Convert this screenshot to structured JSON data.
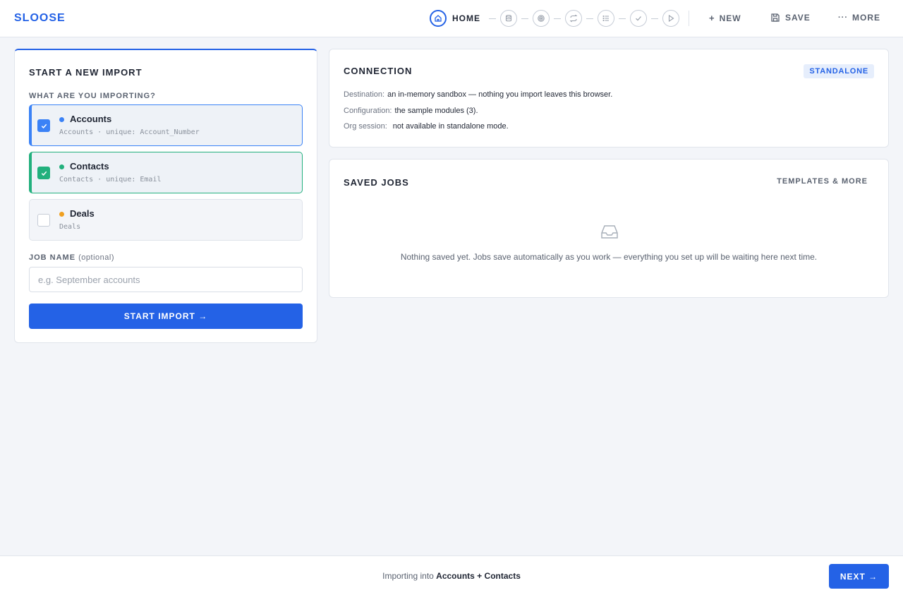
{
  "app": {
    "brand": "SLOOSE"
  },
  "stepper": {
    "active_label": "HOME",
    "steps": [
      {
        "icon": "home-icon",
        "active": true
      },
      {
        "icon": "database-icon"
      },
      {
        "icon": "target-icon"
      },
      {
        "icon": "sync-icon"
      },
      {
        "icon": "list-icon"
      },
      {
        "icon": "check-icon"
      },
      {
        "icon": "play-icon"
      }
    ]
  },
  "toolbar": {
    "new_label": "NEW",
    "save_label": "SAVE",
    "more_label": "MORE"
  },
  "import_card": {
    "title": "START A NEW IMPORT",
    "question": "WHAT ARE YOU IMPORTING?",
    "options": [
      {
        "name": "Accounts",
        "sub": "Accounts · unique: Account_Number",
        "checked": true,
        "color": "#3b82f6"
      },
      {
        "name": "Contacts",
        "sub": "Contacts · unique: Email",
        "checked": true,
        "color": "#22b07d"
      },
      {
        "name": "Deals",
        "sub": "Deals",
        "checked": false,
        "color": "#f0a020"
      }
    ],
    "job_name_label": "JOB NAME",
    "job_name_optional": "(optional)",
    "job_name_placeholder": "e.g. September accounts",
    "start_button": "START IMPORT →"
  },
  "connection": {
    "title": "CONNECTION",
    "badge": "STANDALONE",
    "destination_key": "Destination:",
    "destination_val": "an in-memory sandbox — nothing you import leaves this browser.",
    "config_key": "Configuration:",
    "config_val": "the sample modules (3).",
    "session_key": "Org session:",
    "session_val": "not available in standalone mode."
  },
  "saved_jobs": {
    "title": "SAVED JOBS",
    "link": "TEMPLATES & MORE",
    "empty": "Nothing saved yet. Jobs save automatically as you work — everything you set up will be waiting here next time."
  },
  "footer": {
    "prefix": "Importing into",
    "target": "Accounts + Contacts",
    "next_button": "NEXT →"
  },
  "colors": {
    "accent": "#2462e6",
    "green": "#22b07d",
    "amber": "#f0a020"
  }
}
